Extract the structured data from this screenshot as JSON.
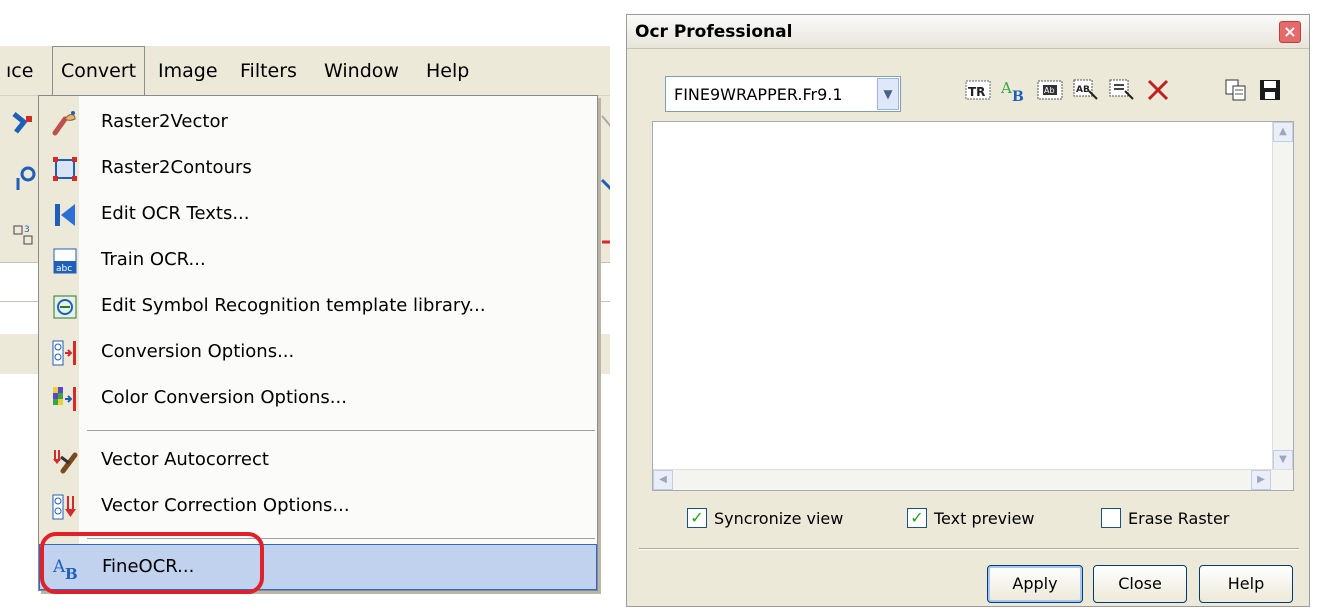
{
  "menubar": {
    "items": [
      "ıce",
      "Convert",
      "Image",
      "Filters",
      "Window",
      "Help"
    ]
  },
  "menu": {
    "items": [
      {
        "label": "Raster2Vector",
        "icon": "raster2vector-icon"
      },
      {
        "label": "Raster2Contours",
        "icon": "raster2contours-icon"
      },
      {
        "label": "Edit OCR Texts...",
        "icon": "edit-ocr-icon"
      },
      {
        "label": "Train OCR...",
        "icon": "train-ocr-icon"
      },
      {
        "label": "Edit Symbol Recognition template library...",
        "icon": "symbol-library-icon"
      },
      {
        "label": "Conversion Options...",
        "icon": "conversion-options-icon"
      },
      {
        "label": "Color Conversion Options...",
        "icon": "color-conversion-icon"
      },
      {
        "label": "Vector Autocorrect",
        "icon": "vector-autocorrect-icon"
      },
      {
        "label": "Vector Correction Options...",
        "icon": "vector-correction-icon"
      },
      {
        "label": "FineOCR...",
        "icon": "fineocr-icon"
      }
    ],
    "selected": "FineOCR..."
  },
  "dialog": {
    "title": "Ocr Professional",
    "engine": "FINE9WRAPPER.Fr9.1",
    "toolbar": [
      "tr-icon",
      "font-ab-icon",
      "text-block-icon",
      "recognize-icon",
      "select-region-icon",
      "delete-icon",
      "copy-icon",
      "save-icon"
    ],
    "checkboxes": [
      {
        "label": "Syncronize view",
        "checked": true
      },
      {
        "label": "Text preview",
        "checked": true
      },
      {
        "label": "Erase Raster",
        "checked": false
      }
    ],
    "buttons": {
      "apply": "Apply",
      "close": "Close",
      "help": "Help"
    }
  }
}
